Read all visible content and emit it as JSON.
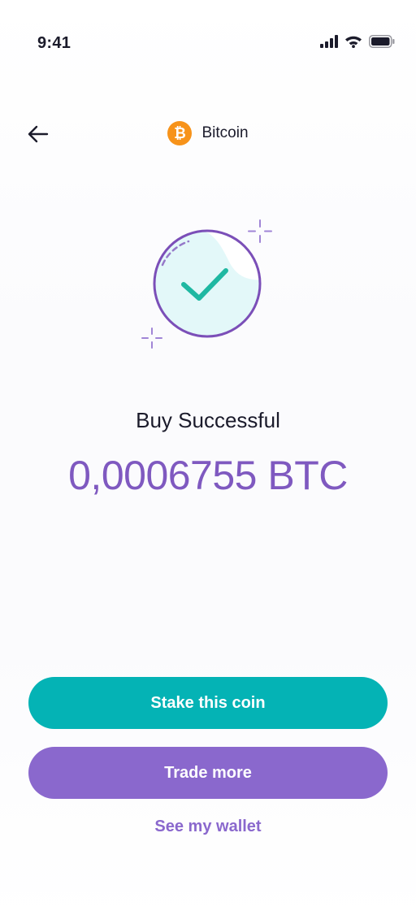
{
  "status_bar": {
    "time": "9:41",
    "icons": [
      "signal-icon",
      "wifi-icon",
      "battery-icon"
    ]
  },
  "header": {
    "back_icon": "arrow-left-icon",
    "coin_icon": "bitcoin-icon",
    "coin_symbol_glyph": "₿",
    "coin_name": "Bitcoin"
  },
  "result": {
    "icon": "check-circle-icon",
    "title": "Buy Successful",
    "amount": "0,0006755 BTC"
  },
  "actions": {
    "stake_label": "Stake this coin",
    "trade_label": "Trade more",
    "wallet_label": "See my wallet"
  },
  "colors": {
    "primary_teal": "#04b3b5",
    "primary_purple": "#8a68cd",
    "amount_purple": "#7f59c0",
    "bitcoin_orange": "#f7931a",
    "check_green": "#1fb8a2",
    "circle_stroke": "#7b4fb8"
  }
}
